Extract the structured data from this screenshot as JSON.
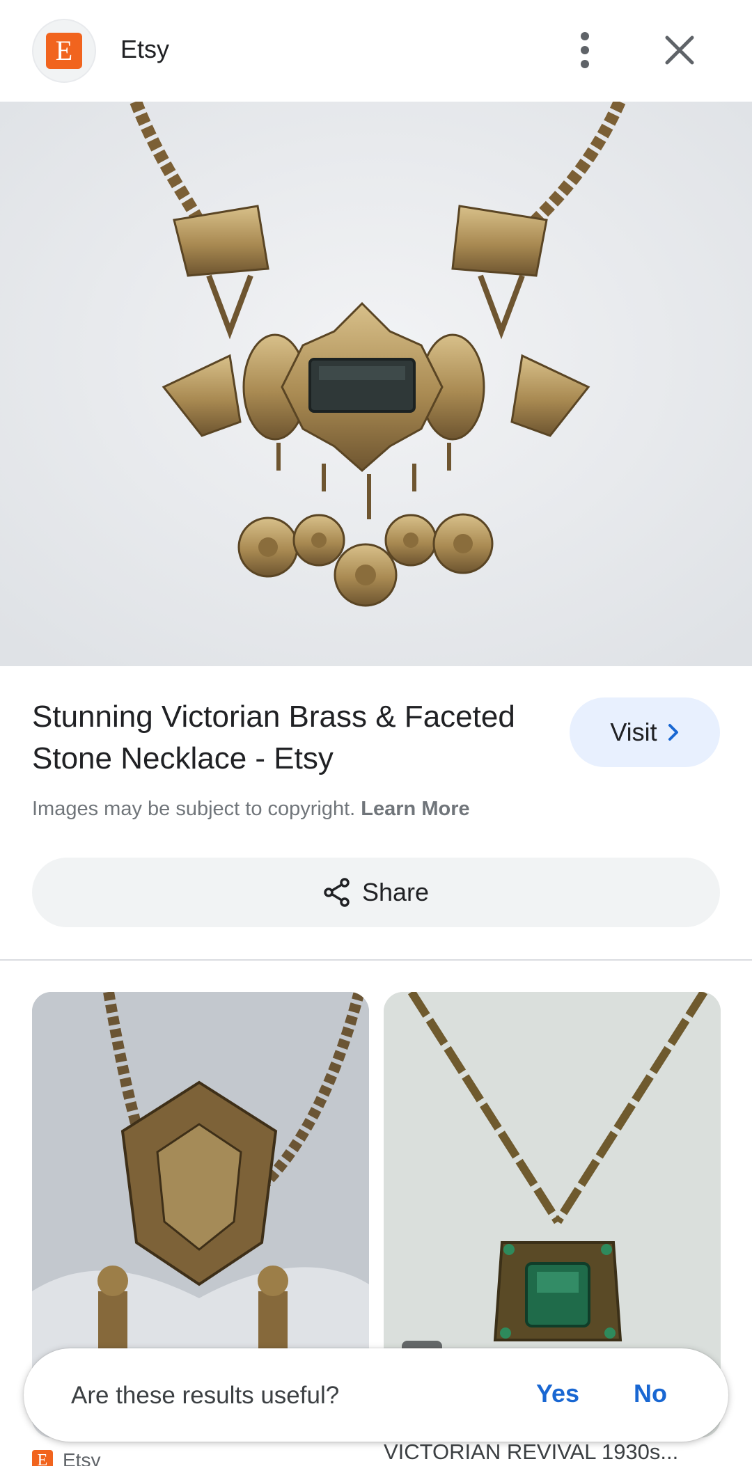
{
  "header": {
    "site_logo_letter": "E",
    "site_name": "Etsy",
    "menu_icon": "more-vert-icon",
    "close_icon": "close-icon"
  },
  "result": {
    "title": "Stunning Victorian Brass & Faceted Stone Necklace - Etsy",
    "visit_label": "Visit",
    "copyright_text": "Images may be subject to copyright.",
    "learn_more": "Learn More",
    "share_label": "Share"
  },
  "related": [
    {
      "source": "Etsy",
      "title": ""
    },
    {
      "source": "",
      "title": "VICTORIAN REVIVAL 1930s..."
    }
  ],
  "feedback": {
    "question": "Are these results useful?",
    "yes": "Yes",
    "no": "No"
  },
  "colors": {
    "brand": "#f1641e",
    "accent_blue": "#1967d2",
    "visit_bg": "#e8f0fe"
  }
}
